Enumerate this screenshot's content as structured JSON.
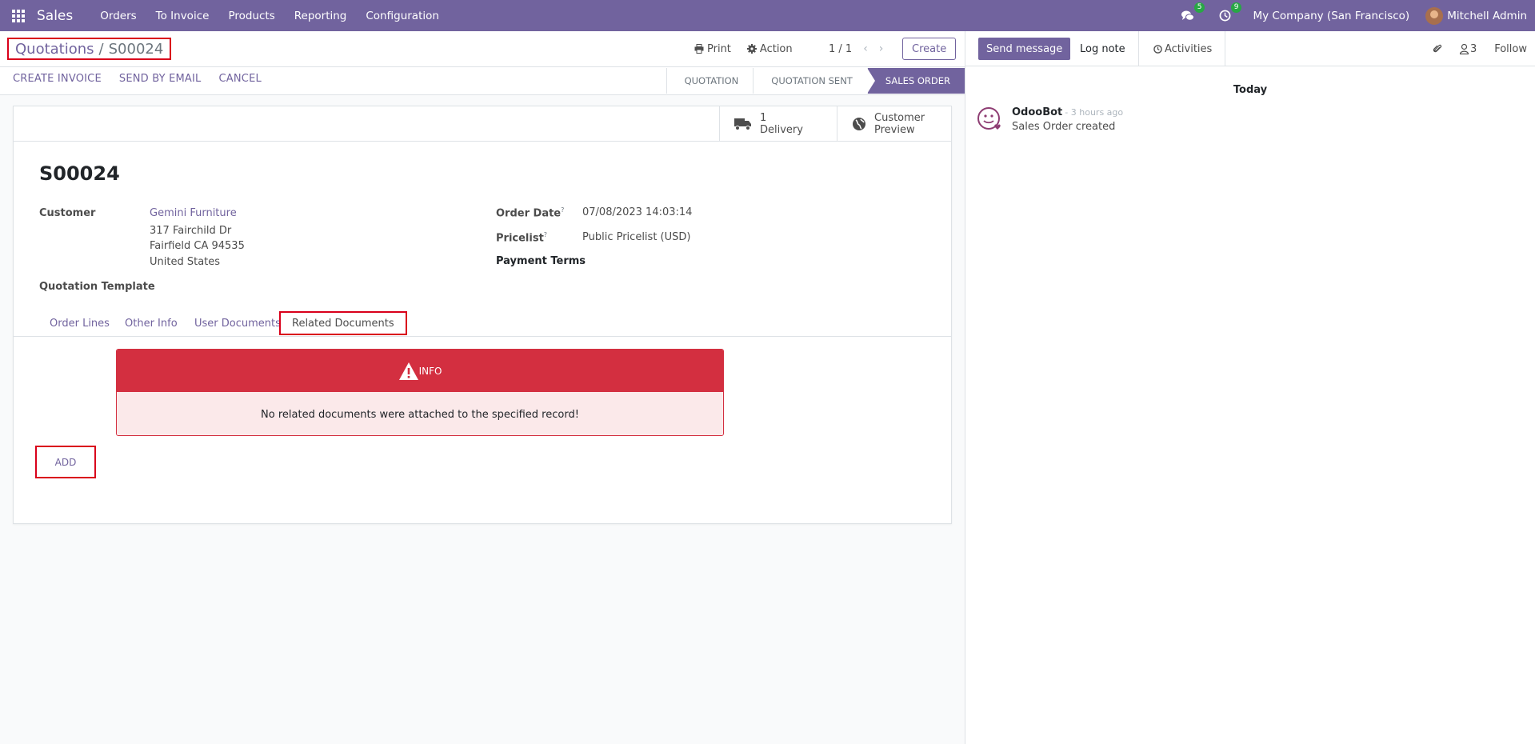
{
  "navbar": {
    "app_name": "Sales",
    "menu": [
      "Orders",
      "To Invoice",
      "Products",
      "Reporting",
      "Configuration"
    ],
    "messages_count": "5",
    "activities_count": "9",
    "company": "My Company (San Francisco)",
    "user": "Mitchell Admin"
  },
  "control_panel": {
    "breadcrumb_parent": "Quotations",
    "breadcrumb_sep": "/",
    "breadcrumb_current": "S00024",
    "print_label": "Print",
    "action_label": "Action",
    "pager": "1 / 1",
    "create_label": "Create",
    "status_buttons": [
      "CREATE INVOICE",
      "SEND BY EMAIL",
      "CANCEL"
    ],
    "stages": [
      "QUOTATION",
      "QUOTATION SENT",
      "SALES ORDER"
    ],
    "active_stage": "SALES ORDER"
  },
  "form": {
    "delivery_count": "1",
    "delivery_label": "Delivery",
    "customer_preview_line1": "Customer",
    "customer_preview_line2": "Preview",
    "title": "S00024",
    "customer_label": "Customer",
    "customer_name": "Gemini Furniture",
    "customer_street": "317 Fairchild Dr",
    "customer_city": "Fairfield CA 94535",
    "customer_country": "United States",
    "quotation_template_label": "Quotation Template",
    "order_date_label": "Order Date",
    "order_date": "07/08/2023 14:03:14",
    "pricelist_label": "Pricelist",
    "pricelist": "Public Pricelist (USD)",
    "payment_terms_label": "Payment Terms",
    "help_mark": "?",
    "tabs": [
      "Order Lines",
      "Other Info",
      "User Documents",
      "Related Documents"
    ],
    "active_tab": "Related Documents",
    "alert_title": "INFO",
    "alert_message": "No related documents were attached to the specified record!",
    "add_label": "ADD"
  },
  "chatter": {
    "send_message": "Send message",
    "log_note": "Log note",
    "activities": "Activities",
    "followers_count": "3",
    "follow": "Follow",
    "date_separator": "Today",
    "messages": [
      {
        "author": "OdooBot",
        "time": "- 3 hours ago",
        "body": "Sales Order created"
      }
    ]
  },
  "colors": {
    "brand": "#71639e",
    "danger": "#d32f40",
    "badge": "#28a745",
    "highlight": "#d9001b"
  }
}
